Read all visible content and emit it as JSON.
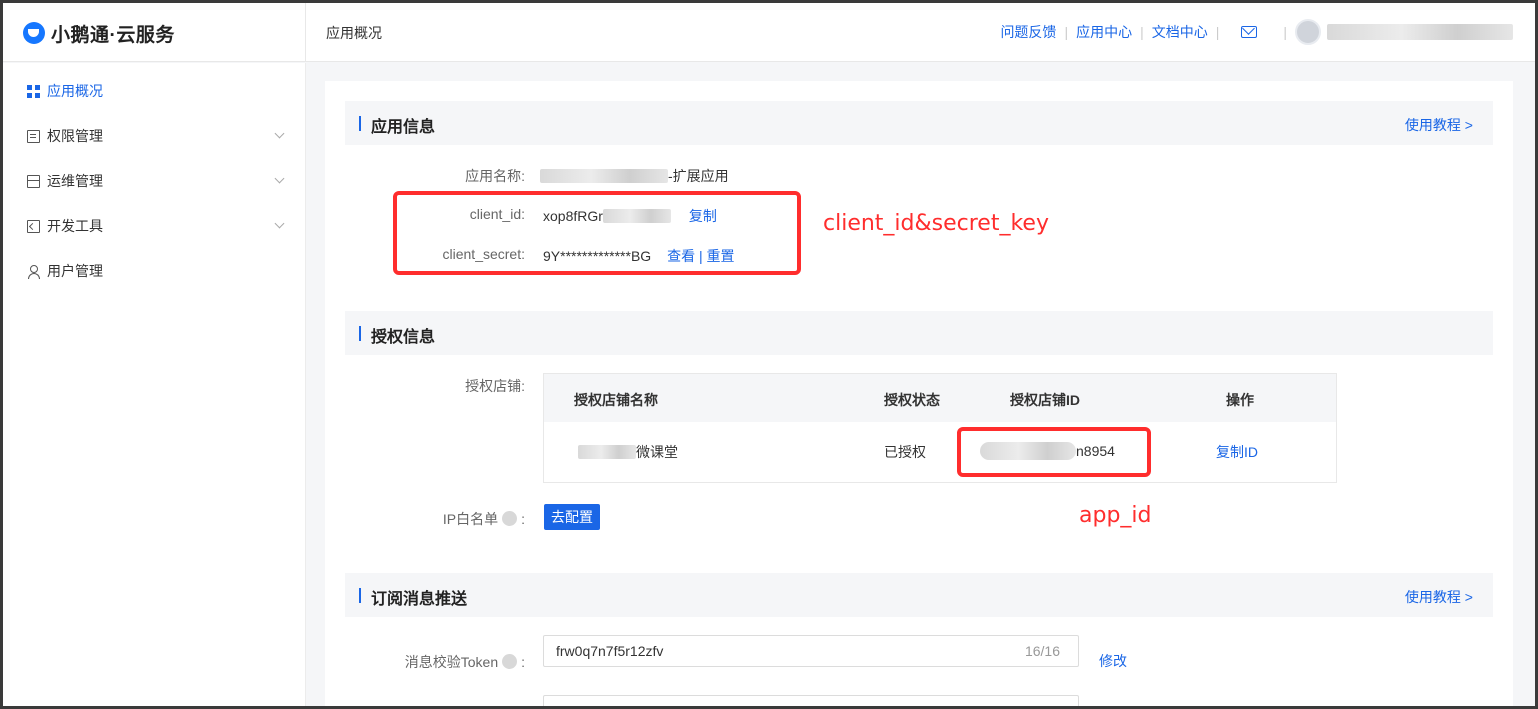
{
  "header": {
    "logo_text": "小鹅通·云服务",
    "page_title": "应用概况",
    "nav": [
      "问题反馈",
      "应用中心",
      "文档中心"
    ],
    "separator": "|"
  },
  "sidebar": {
    "items": [
      {
        "label": "应用概况",
        "icon": "grid-icon",
        "active": true
      },
      {
        "label": "权限管理",
        "icon": "document-icon"
      },
      {
        "label": "运维管理",
        "icon": "server-icon"
      },
      {
        "label": "开发工具",
        "icon": "code-icon"
      },
      {
        "label": "用户管理",
        "icon": "user-icon"
      }
    ]
  },
  "app_info": {
    "title": "应用信息",
    "tutorial": "使用教程 >",
    "name_label": "应用名称:",
    "name_suffix": "-扩展应用",
    "client_id_label": "client_id:",
    "client_id_value": "xop8fRGr",
    "copy": "复制",
    "client_secret_label": "client_secret:",
    "client_secret_value": "9Y*************BG",
    "view": "查看",
    "reset": "重置",
    "divider": "|"
  },
  "auth_info": {
    "title": "授权信息",
    "shop_label": "授权店铺:",
    "columns": [
      "授权店铺名称",
      "授权状态",
      "授权店铺ID",
      "操作"
    ],
    "row": {
      "name_suffix": "微课堂",
      "status": "已授权",
      "id_suffix": "n8954",
      "action": "复制ID"
    },
    "ip_label": "IP白名单",
    "colon": ":",
    "ip_button": "去配置"
  },
  "subscribe": {
    "title": "订阅消息推送",
    "tutorial": "使用教程 >",
    "token_label": "消息校验Token",
    "colon": ":",
    "token_value": "frw0q7n7f5r12zfv",
    "token_count": "16/16",
    "modify": "修改"
  },
  "annotations": {
    "secret": "client_id&secret_key",
    "app_id": "app_id",
    "color": "#ff2d2d"
  },
  "colors": {
    "accent": "#1a66e6",
    "highlight": "#ff2d2d"
  }
}
